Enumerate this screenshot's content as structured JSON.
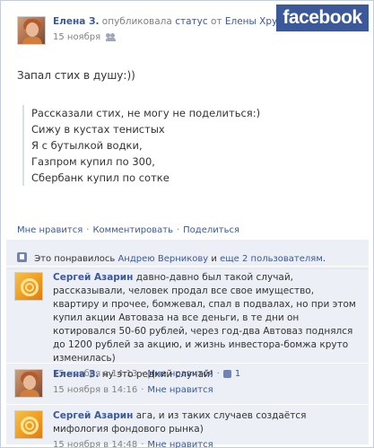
{
  "post": {
    "author": "Елена З.",
    "action": "опубликовала",
    "object": "статус",
    "from_word": "от",
    "source": "Елены Хруповой",
    "date": "15 ноября",
    "logo": "facebook",
    "status_text": "Запал стих в душу:))",
    "quote_lines": [
      "Рассказали стих, не могу не поделиться:)",
      "Сижу в кустах тенистых",
      "Я с бутылкой водки,",
      "Газпром купил по 300,",
      "Сбербанк купил по сотке"
    ]
  },
  "actions": {
    "like": "Мне нравится",
    "comment": "Комментировать",
    "share": "Поделиться",
    "sep": "·"
  },
  "likes": {
    "prefix": "Это понравилось",
    "person": "Андрею Верникову",
    "and": "и",
    "others": "еще 2 пользователям",
    "suffix": "."
  },
  "comments": [
    {
      "author": "Сергей Азарин",
      "text": "давно-давно был такой случай, рассказывали, человек продал все свое имущество, квартиру и прочее, бомжевал, спал в подвалах, но при этом купил акции Автоваза на все деньги, в те дни он котировался 50-60 рублей, через год-два Автоваз поднялся до 1200 рублей за акцию, и жизнь инвестора-бомжа круто изменилась)",
      "time": "15 ноября в 14:13",
      "like": "Мне нравится",
      "like_count": "1"
    },
    {
      "author": "Елена З.",
      "text": "ну это редкий случай!",
      "time": "15 ноября в 14:16",
      "like": "Мне нравится"
    },
    {
      "author": "Сергей Азарин",
      "text": "ага, и из таких случаев создаётся мифология фондового рынка)",
      "time": "15 ноября в 14:48",
      "like": "Мне нравится"
    }
  ],
  "colors": {
    "brand": "#3b5998",
    "ufi_background": "#eceff5",
    "muted": "#808080"
  },
  "icons": {
    "audience": "people-icon",
    "like": "thumbs-up-icon"
  }
}
